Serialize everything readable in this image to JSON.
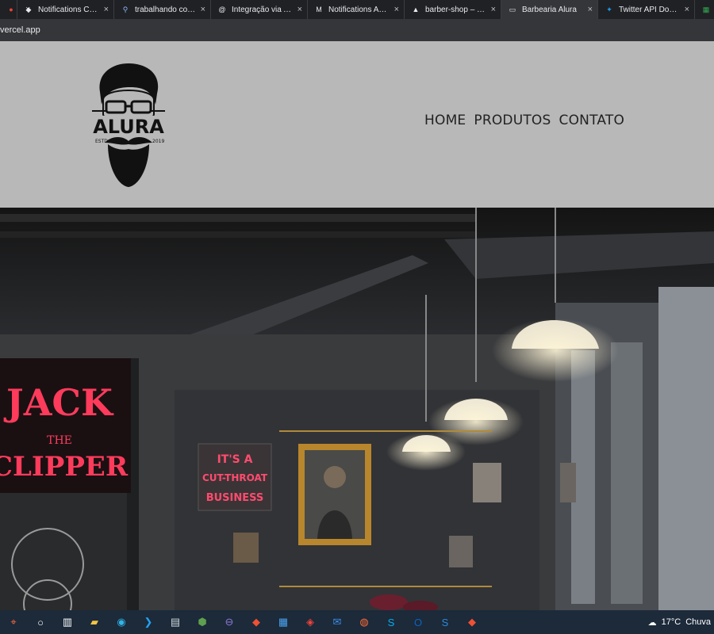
{
  "browser": {
    "tabs": [
      {
        "label": "",
        "icon": "app-icon",
        "active": false
      },
      {
        "label": "Notifications Colle",
        "icon": "github-icon",
        "active": false
      },
      {
        "label": "trabalhando com /",
        "icon": "search-icon",
        "active": false
      },
      {
        "label": "Integração via API",
        "icon": "threads-icon",
        "active": false
      },
      {
        "label": "Notifications API -",
        "icon": "medium-icon",
        "active": false
      },
      {
        "label": "barber-shop – Ove",
        "icon": "vercel-icon",
        "active": false
      },
      {
        "label": "Barbearia Alura",
        "icon": "page-icon",
        "active": true
      },
      {
        "label": "Twitter API Docum",
        "icon": "twitter-icon",
        "active": false
      },
      {
        "label": "",
        "icon": "chart-icon",
        "active": false
      }
    ],
    "close_glyph": "×",
    "address": "vercel.app"
  },
  "site": {
    "logo": {
      "text": "ALURA",
      "estd": "ESTD",
      "year": "2019"
    },
    "nav": [
      "HOME",
      "PRODUTOS",
      "CONTATO"
    ],
    "hero": {
      "neon_sign_1": [
        "JACK",
        "THE",
        "CLIPPER"
      ],
      "neon_sign_2": [
        "IT'S A",
        "CUT-THROAT",
        "BUSINESS"
      ]
    }
  },
  "taskbar": {
    "icons": [
      "maps-icon",
      "search-circle-icon",
      "task-view-icon",
      "file-explorer-icon",
      "edge-icon",
      "vscode-icon",
      "notepad-icon",
      "node-icon",
      "app-purple-icon",
      "git-icon",
      "store-icon",
      "anydesk-icon",
      "mail-icon",
      "postman-icon",
      "skype-icon",
      "outlook-icon",
      "azure-icon",
      "sourcetree-icon"
    ],
    "weather": {
      "temp": "17°C",
      "condition": "Chuva"
    }
  }
}
